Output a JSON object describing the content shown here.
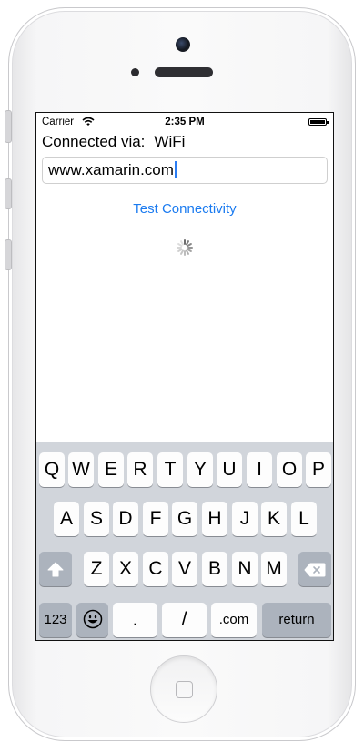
{
  "status": {
    "carrier": "Carrier",
    "time": "2:35 PM"
  },
  "connection": {
    "label": "Connected via:",
    "value": "WiFi"
  },
  "url_field": {
    "value": "www.xamarin.com"
  },
  "test_button": {
    "label": "Test Connectivity"
  },
  "keyboard": {
    "row1": [
      "Q",
      "W",
      "E",
      "R",
      "T",
      "Y",
      "U",
      "I",
      "O",
      "P"
    ],
    "row2": [
      "A",
      "S",
      "D",
      "F",
      "G",
      "H",
      "J",
      "K",
      "L"
    ],
    "row3": [
      "Z",
      "X",
      "C",
      "V",
      "B",
      "N",
      "M"
    ],
    "row4": {
      "numbers": "123",
      "dot": ".",
      "slash": "/",
      "dotcom": ".com",
      "return": "return"
    }
  },
  "colors": {
    "link": "#1b7bf0",
    "keyboard_bg": "#d1d5db",
    "dark_key": "#acb3bd"
  }
}
